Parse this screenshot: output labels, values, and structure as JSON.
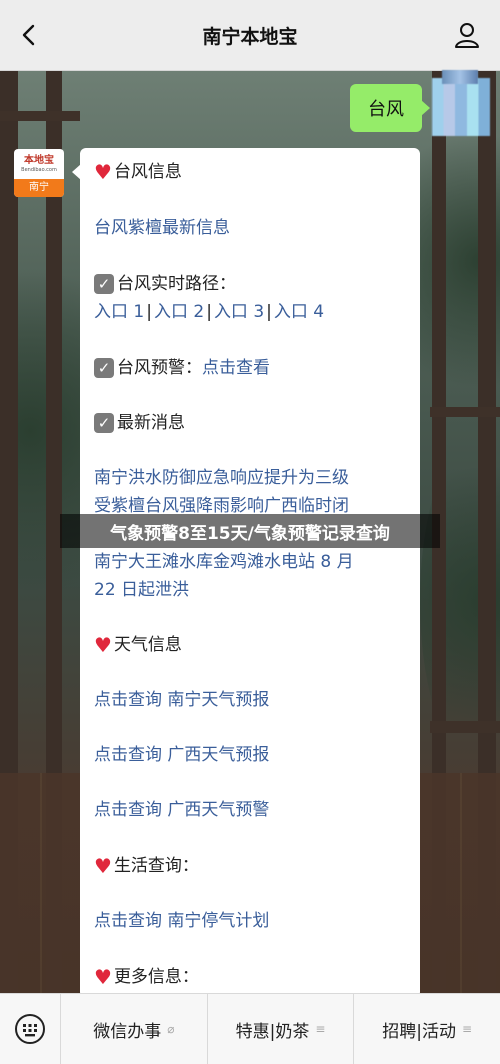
{
  "header": {
    "title": "南宁本地宝"
  },
  "chat": {
    "user_message": "台风",
    "bot_avatar": {
      "brand": "本地宝",
      "url": "Bendibao.com",
      "city": "南宁"
    }
  },
  "card": {
    "typhoon_info": {
      "heading": "台风信息",
      "link": "台风紫檀最新信息"
    },
    "typhoon_path": {
      "heading": "台风实时路径：",
      "entrances": [
        "入口 1",
        "入口 2",
        "入口 3",
        "入口 4"
      ]
    },
    "typhoon_warning": {
      "heading": "台风预警：",
      "link": "点击查看"
    },
    "latest_news": {
      "heading": "最新消息",
      "items": [
        "南宁洪水防御应急响应提升为三级",
        "受紫檀台风强降雨影响广西临时闭",
        "南宁大王滩水库金鸡滩水电站 8 月",
        "22 日起泄洪"
      ]
    },
    "weather_info": {
      "heading": "天气信息",
      "links": [
        "点击查询 南宁天气预报",
        "点击查询 广西天气预报",
        "点击查询 广西天气预警"
      ]
    },
    "life_query": {
      "heading": "生活查询：",
      "link": "点击查询 南宁停气计划"
    },
    "more_info": {
      "heading": "更多信息："
    }
  },
  "overlay_title": "气象预警8至15天/气象预警记录查询",
  "bottom_menu": {
    "items": [
      {
        "label": "微信办事",
        "mark": "link-icon"
      },
      {
        "label": "特惠|奶茶",
        "mark": "menu-icon"
      },
      {
        "label": "招聘|活动",
        "mark": "menu-icon"
      }
    ]
  },
  "colors": {
    "bubble_green": "#95ec69",
    "link_blue": "#3a5e9a",
    "heart_red": "#e0273b"
  }
}
